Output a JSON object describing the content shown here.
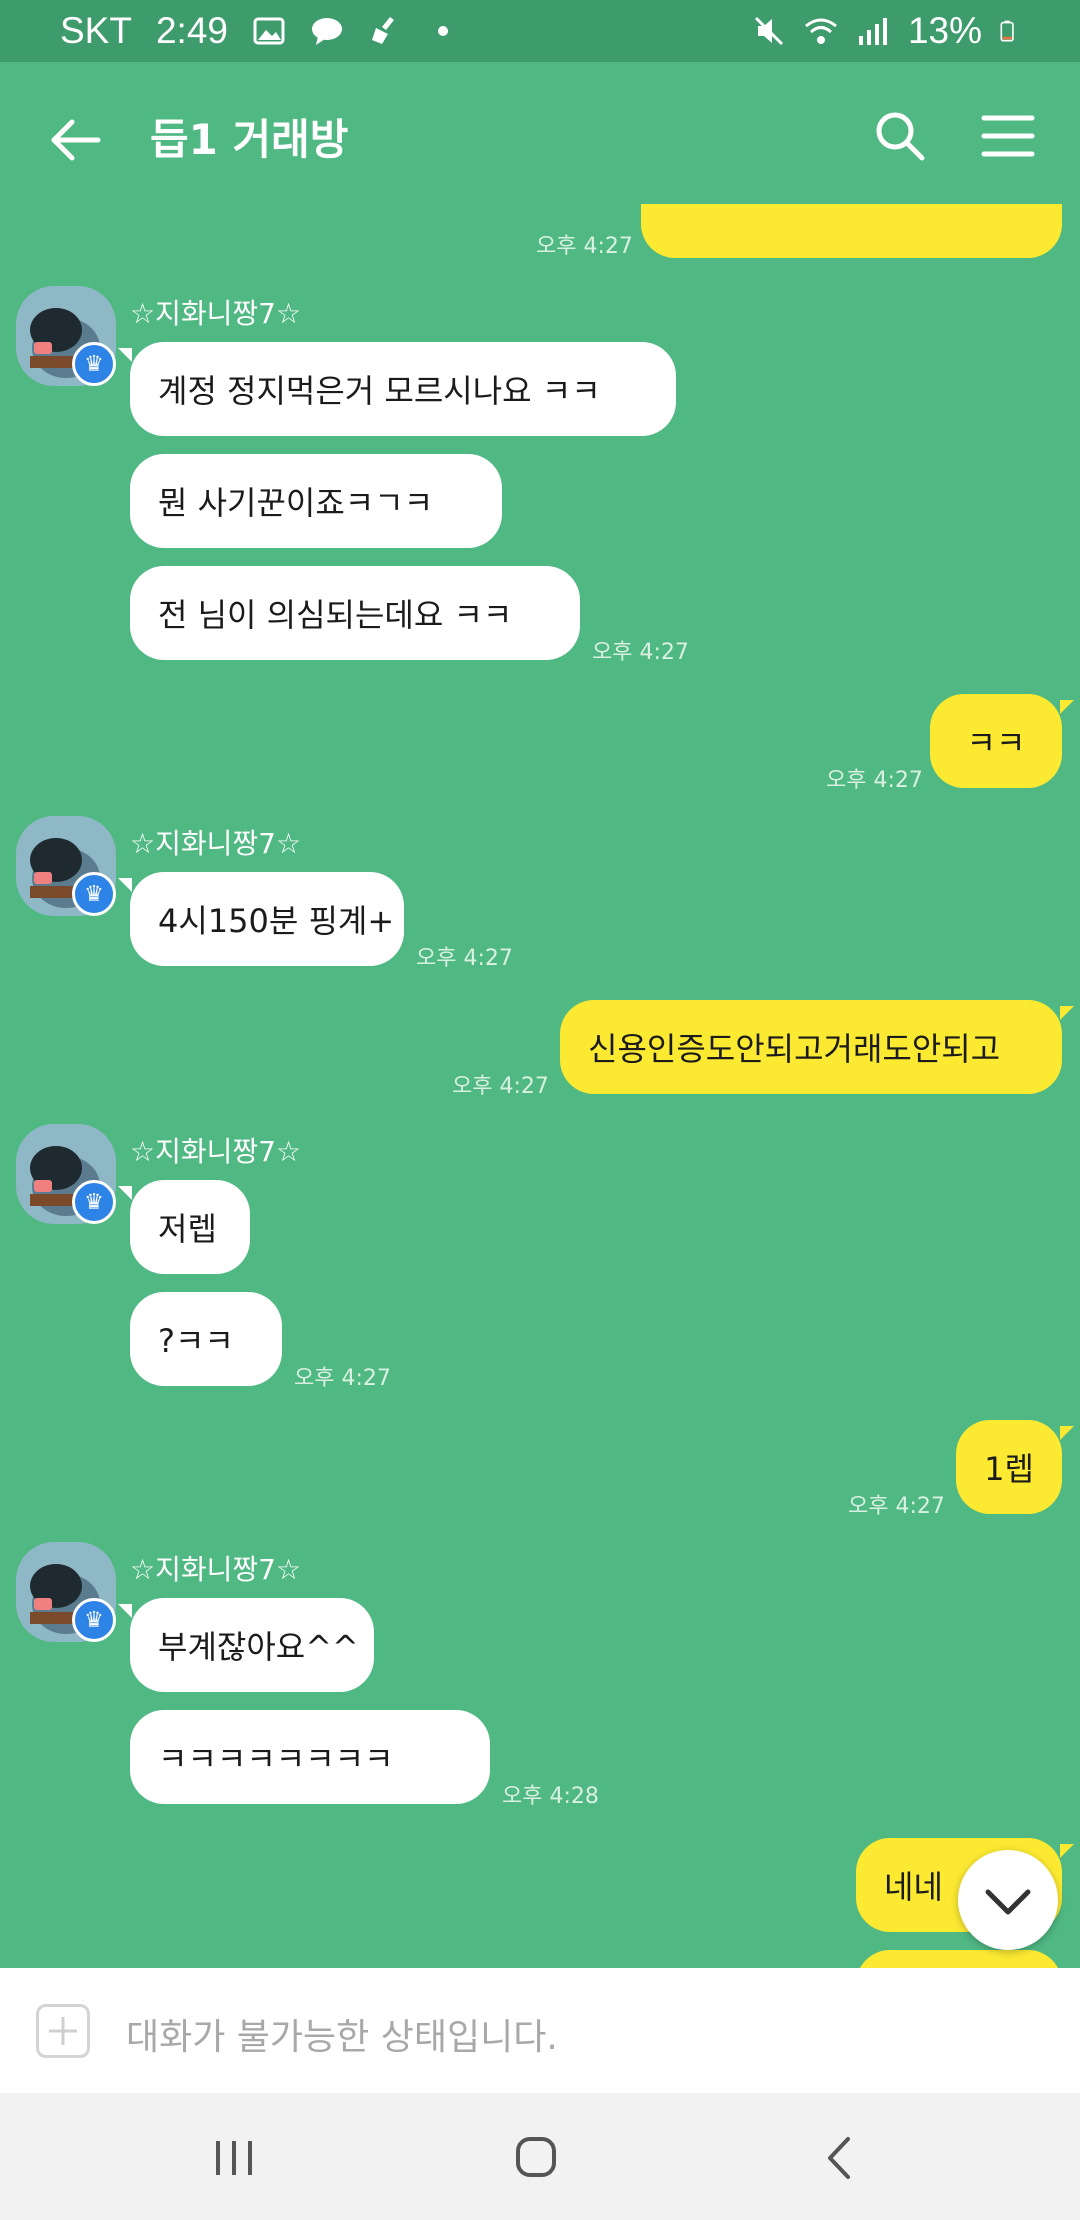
{
  "status_bar": {
    "carrier": "SKT",
    "time": "2:49",
    "battery": "13%",
    "icons": [
      "image-icon",
      "talk-icon",
      "broom-icon",
      "dot-icon",
      "mute-icon",
      "wifi-icon",
      "signal-icon",
      "battery-icon"
    ]
  },
  "header": {
    "title": "듭1 거래방",
    "icons": [
      "back-arrow-icon",
      "search-icon",
      "hamburger-menu-icon"
    ]
  },
  "messages": {
    "m0": {
      "text": "",
      "time": "오후 4:27",
      "side": "out"
    },
    "sender1": "☆지화니짱7☆",
    "m1": {
      "text": "계정 정지먹은거 모르시나요 ㅋㅋ",
      "side": "in"
    },
    "m2": {
      "text": "뭔 사기꾼이죠ㅋㄱㅋ",
      "side": "in"
    },
    "m3": {
      "text": "전 님이 의심되는데요 ㅋㅋ",
      "time": "오후 4:27",
      "side": "in"
    },
    "m4": {
      "text": "ㅋㅋ",
      "time": "오후 4:27",
      "side": "out"
    },
    "sender2": "☆지화니짱7☆",
    "m5": {
      "text": "4시150분 핑계+",
      "time": "오후 4:27",
      "side": "in"
    },
    "m6": {
      "text": "신용인증도안되고거래도안되고",
      "time": "오후 4:27",
      "side": "out"
    },
    "sender3": "☆지화니짱7☆",
    "m7": {
      "text": "저렙",
      "side": "in"
    },
    "m8": {
      "text": "?ㅋㅋ",
      "time": "오후 4:27",
      "side": "in"
    },
    "m9": {
      "text": "1렙",
      "time": "오후 4:27",
      "side": "out"
    },
    "sender4": "☆지화니짱7☆",
    "m10": {
      "text": "부계잖아요^^",
      "side": "in"
    },
    "m11": {
      "text": "ㅋㅋㅋㅋㅋㅋㅋㅋ",
      "time": "오후 4:28",
      "side": "in"
    },
    "m12": {
      "text": "네네",
      "side": "out"
    }
  },
  "input": {
    "placeholder": "대화가 불가능한 상태입니다."
  },
  "nav": {
    "icons": [
      "recent-apps-icon",
      "home-icon",
      "back-icon"
    ]
  },
  "colors": {
    "chat_background": "#50b883",
    "status_bar": "#3d9b6c",
    "incoming_bubble": "#ffffff",
    "outgoing_bubble": "#fbe932",
    "badge": "#2e84e6"
  }
}
